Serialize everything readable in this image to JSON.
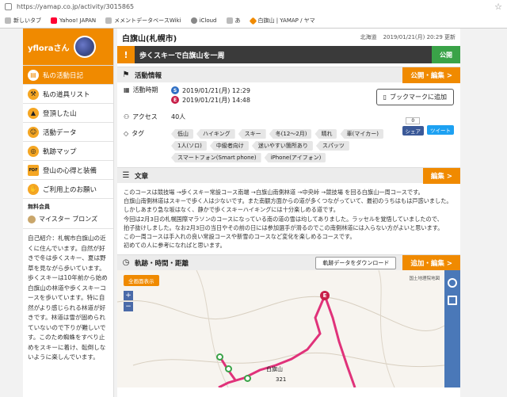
{
  "browser": {
    "url": "https://yamap.co.jp/activity/3015865",
    "bookmarks": [
      "新しいタブ",
      "Yahoo! JAPAN",
      "メメントデータベースWiki",
      "iCloud",
      "あ",
      "白旗山 | YAMAP / ヤマ"
    ]
  },
  "sidebar": {
    "username": "yfloraさん",
    "items": [
      {
        "label": "私の活動日記",
        "icon": "diary-icon",
        "active": true
      },
      {
        "label": "私の道具リスト",
        "icon": "tool-icon"
      },
      {
        "label": "登頂した山",
        "icon": "mountain-icon"
      },
      {
        "label": "活動データ",
        "icon": "data-icon"
      },
      {
        "label": "軌跡マップ",
        "icon": "map-icon"
      },
      {
        "label": "登山の心得と装備",
        "icon": "pdf-icon"
      },
      {
        "label": "ご利用上のお願い",
        "icon": "hand-icon"
      }
    ],
    "member_label": "無料会員",
    "rank": "マイスター ブロンズ",
    "intro": "自己紹介：札幌市白旗山の近くに住んでいます。自然が好きで冬は歩くスキー、夏は野草を見ながら歩いています。歩くスキーは10年前から始め白旗山の林道や歩くスキーコースを歩いています。特に自然がより感じられる林道が好きです。林道は雪が固められていないので下りが難しいです。このため蜘蛛をすべり止めをスキーに着け、転倒しないように楽しんでいます。"
  },
  "header": {
    "mountain": "白旗山(札幌市)",
    "region": "北海道",
    "updated": "2019/01/21(月) 20:29 更新"
  },
  "activity": {
    "title": "歩くスキーで白旗山を一周",
    "status": "公開"
  },
  "info": {
    "section_title": "活動情報",
    "edit": "公開・編集 >",
    "period_label": "活動時期",
    "start": "2019/01/21(月) 12:29",
    "end": "2019/01/21(月) 14:48",
    "bookmark": "ブックマークに追加",
    "access_label": "アクセス",
    "access": "40人",
    "share_count": "0",
    "share": "シェア",
    "tweet": "ツイート",
    "tag_label": "タグ",
    "tags": [
      "低山",
      "ハイキング",
      "スキー",
      "冬(12〜2月)",
      "晴れ",
      "車(マイカー)",
      "1人(ソロ)",
      "中級者向け",
      "迷いやすい箇所あり",
      "スパッツ",
      "スマートフォン(Smart phone)",
      "iPhone(アイフォン)"
    ]
  },
  "article": {
    "section_title": "文章",
    "edit": "編集 >",
    "lines": [
      "このコースは競技場 →歩くスキー常設コース南端 →白旗山南側林道 →中央峠 →競技場 を回る白旗山一周コースです。",
      "白旗山南側林道はスキーで歩く人は少ないです。また南観方面からの道が多くつながっていて、最初のうちはもは戸惑いました。",
      "しかしあまり急な坂はなく、静かで歩くスキーハイキングには十分楽しめる道です。",
      "今回は2月3日の札幌国際マラソンのコースになっている南の道の雪は均してありました。ラッセルを覚悟していましたので、",
      "拍子抜けしました。なお2月3日の当日やその前の日には参加選手が滑るのでこの南側林道には入らない方がよいと思います。",
      "この一周コースは手入れの良い常設コースや新雪のコースなど変化を楽しめるコースです。",
      "初めての人に参考になればと思います。"
    ]
  },
  "track": {
    "section_title": "軌跡・時間・距離",
    "download": "軌跡データをダウンロード",
    "edit": "追加・編集 >",
    "fullscreen": "全画面表示",
    "map_credit": "国土地理院地図",
    "place": "白旗山",
    "elevation": "321"
  },
  "colors": {
    "accent": "#f08a00",
    "public": "#3aa348",
    "start": "#2f6fc4",
    "end": "#c8204a",
    "track": "#e0327a"
  }
}
